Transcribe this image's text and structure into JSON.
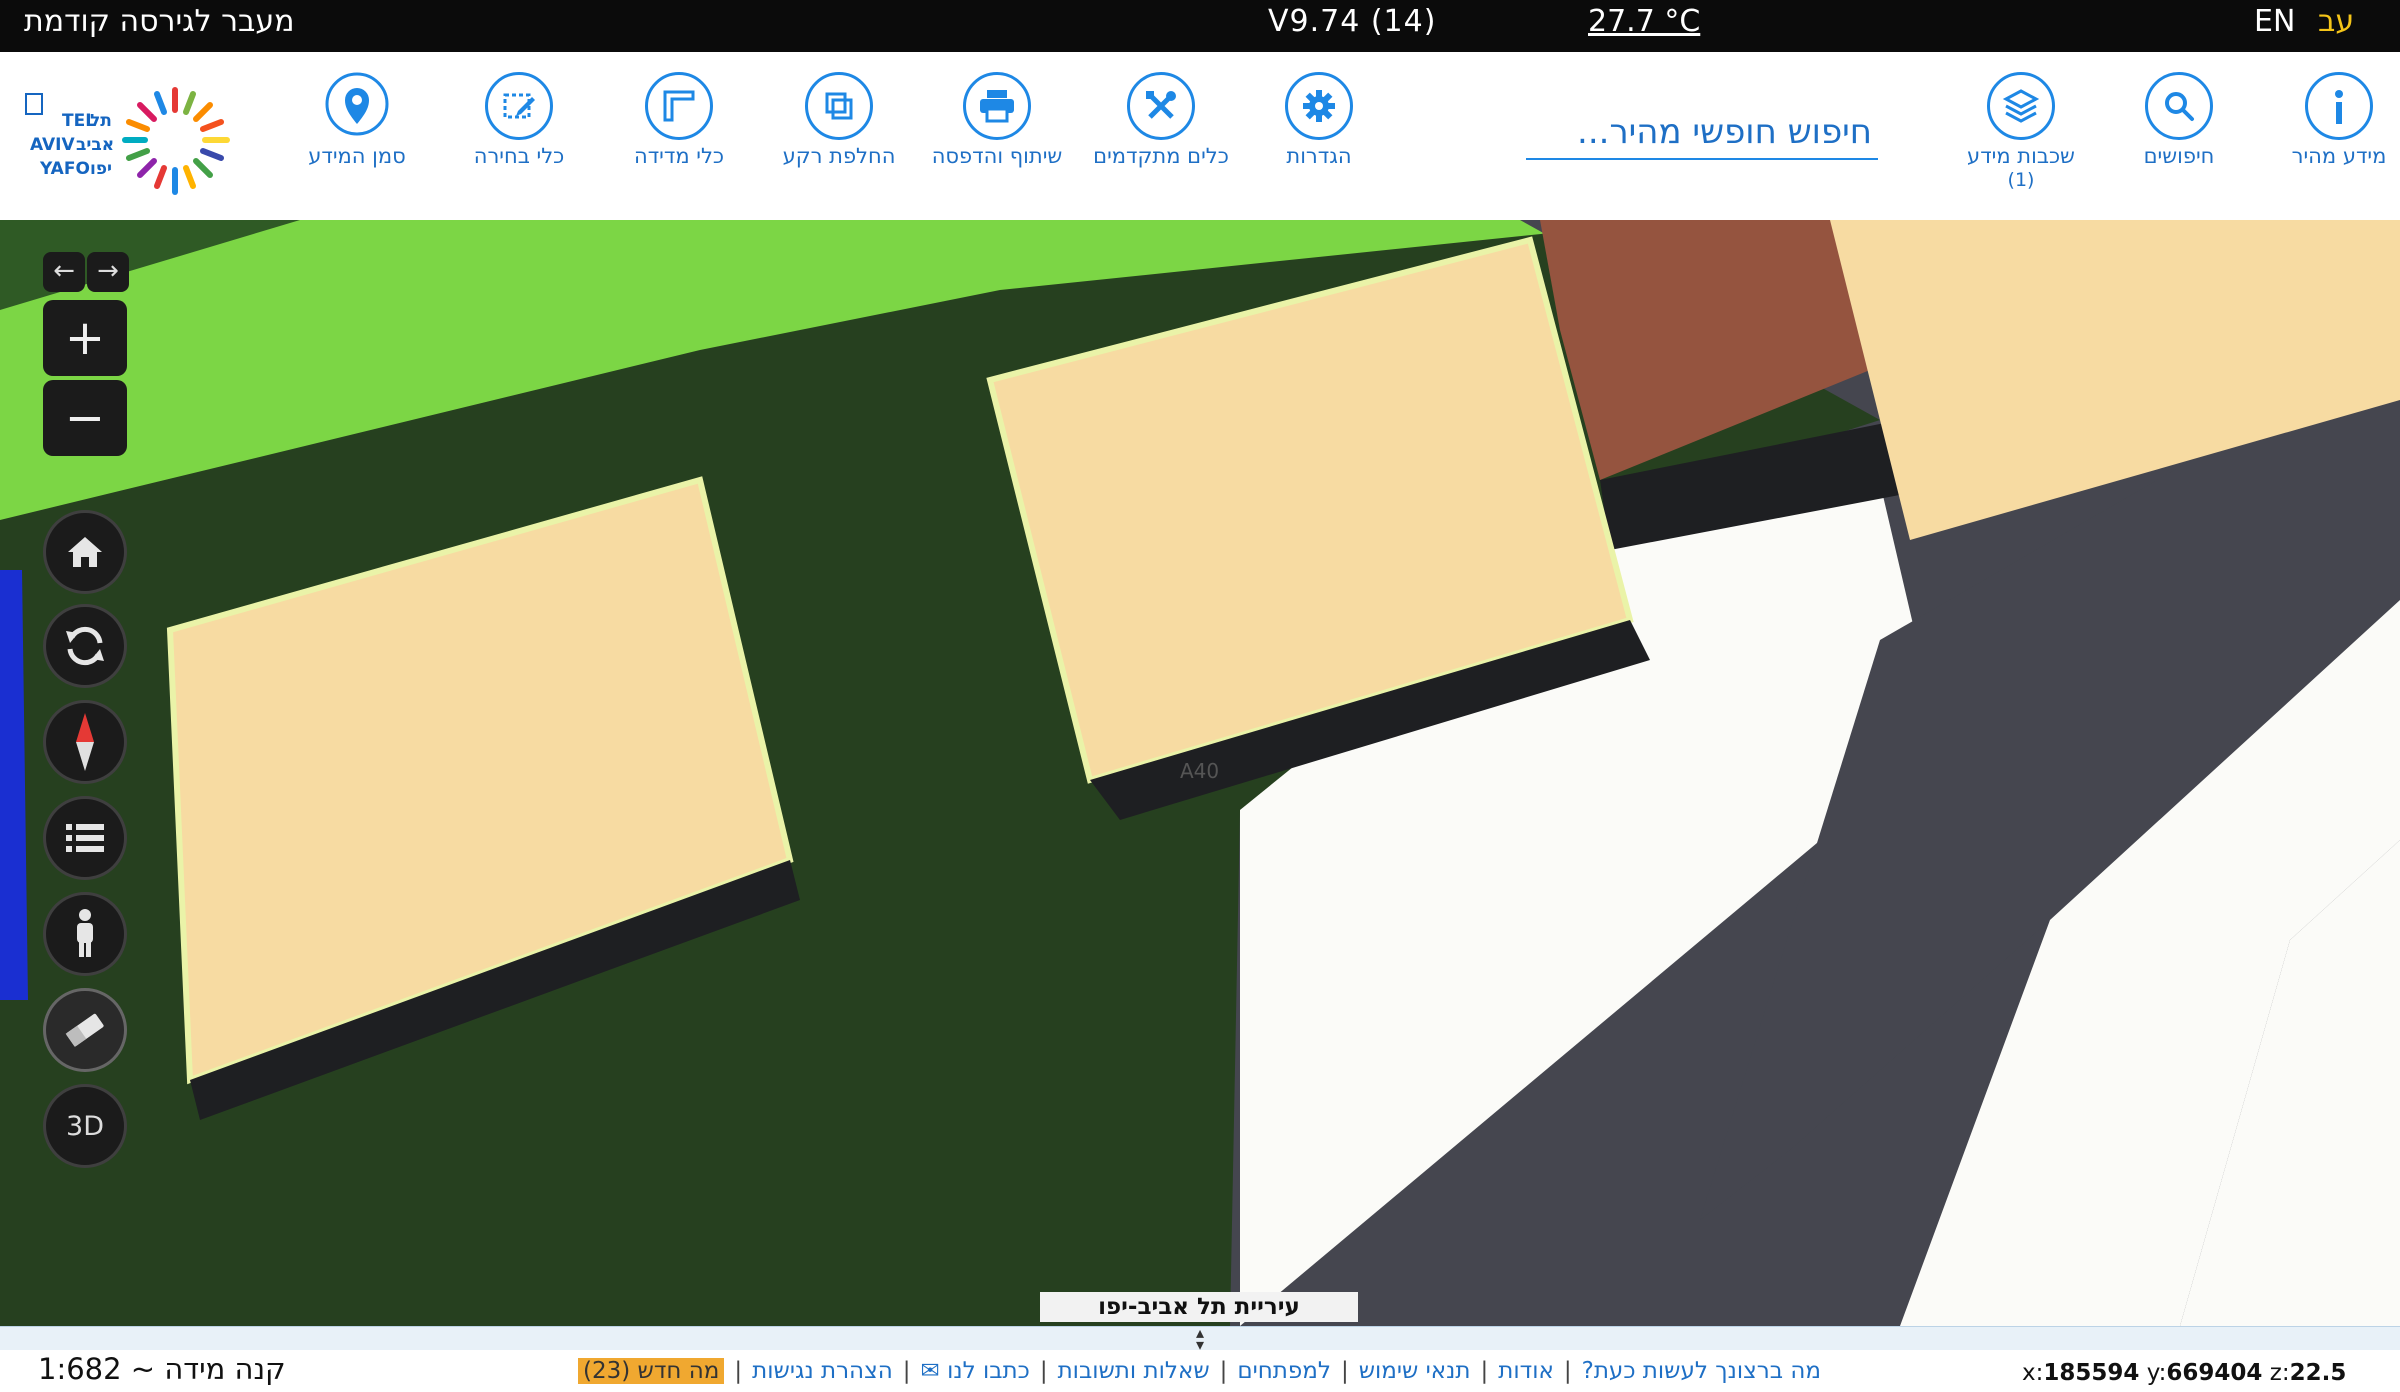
{
  "topbar": {
    "previous_version": "מעבר לגירסה קודמת",
    "version": "V9.74 (14)",
    "temperature": "27.7 °C",
    "lang_en": "EN",
    "lang_he": "עב"
  },
  "toolbar": {
    "tools": [
      {
        "id": "quick-info",
        "label": "מידע מהיר",
        "icon": "info-icon"
      },
      {
        "id": "searches",
        "label": "חיפושים",
        "icon": "magnifier-icon"
      },
      {
        "id": "info-layers",
        "label": "שכבות מידע",
        "count": "(1)",
        "icon": "layers-icon"
      },
      {
        "id": "settings",
        "label": "הגדרות",
        "icon": "gear-icon"
      },
      {
        "id": "advanced-tools",
        "label": "כלים מתקדמים",
        "icon": "tools-icon"
      },
      {
        "id": "share-print",
        "label": "שיתוף והדפסה",
        "icon": "printer-icon"
      },
      {
        "id": "basemap",
        "label": "החלפת רקע",
        "icon": "basemap-icon"
      },
      {
        "id": "measure",
        "label": "כלי מדידה",
        "icon": "ruler-icon"
      },
      {
        "id": "select",
        "label": "כלי בחירה",
        "icon": "select-icon"
      },
      {
        "id": "info-marker",
        "label": "סמן המידע",
        "icon": "pin-icon"
      }
    ],
    "search_placeholder": "חיפוש חופשי מהיר...",
    "logo_text": {
      "line1": "TEL",
      "line1_he": "תל",
      "line2": "AVIV",
      "line2_he": "אביב",
      "line3": "YAFO",
      "line3_he": "יפו"
    }
  },
  "map": {
    "label": "עיריית תל אביב-יפו",
    "building_label": "A40",
    "colors": {
      "grass": "#7cd645",
      "dark_green": "#26401f",
      "building": "#f7dba2",
      "brown": "#95543f",
      "road": "#45464f",
      "white": "#fbfbf8",
      "water": "#1a2fd1"
    }
  },
  "controls": {
    "pan_left": "←",
    "pan_right": "→",
    "zoom_in": "+",
    "zoom_out": "−",
    "label_3d": "3D"
  },
  "bottombar": {
    "scale_text": "קנה מידה ~ 1:682",
    "links": [
      "מה ברצונך לעשות כעת?",
      "אודות",
      "תנאי שימוש",
      "למפתחים",
      "שאלות ותשובות",
      "כתבו לנו ✉",
      "הצהרת נגישות"
    ],
    "whats_new": "מה חדש (23)",
    "coords": {
      "x_label": "x:",
      "x": "185594",
      "y_label": "y:",
      "y": "669404",
      "z_label": "z:",
      "z": "22.5"
    }
  }
}
